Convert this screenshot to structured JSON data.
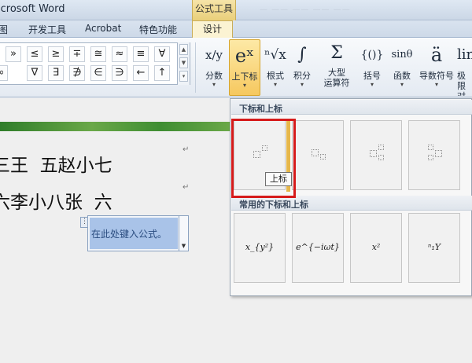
{
  "titlebar": {
    "app_title": "icrosoft Word",
    "context_tab_title": "公式工具",
    "ghost_text": "— ——  ——  —— ——"
  },
  "tabs": {
    "items": [
      "图",
      "开发工具",
      "Acrobat",
      "特色功能"
    ],
    "active": "设计"
  },
  "symbols": {
    "row1": [
      "»",
      "≤",
      "≥",
      "∓",
      "≅",
      "≈",
      "≡",
      "∀"
    ],
    "row2": [
      "∞",
      "∇",
      "∃",
      "∌",
      "∈",
      "∋",
      "←",
      "↑"
    ]
  },
  "ribbon": {
    "fraction": {
      "glyph": "x/y",
      "label": "分数"
    },
    "script": {
      "glyph": "eˣ",
      "label": "上下标"
    },
    "radical": {
      "glyph": "ⁿ√x",
      "label": "根式"
    },
    "integral": {
      "glyph": "∫",
      "label": "积分"
    },
    "large_operator": {
      "glyph": "Σ",
      "label1": "大型",
      "label2": "运算符"
    },
    "bracket": {
      "glyph": "{()}",
      "label": "括号"
    },
    "function": {
      "glyph": "sinθ",
      "label": "函数"
    },
    "accent": {
      "glyph": "ä",
      "label": "导数符号"
    },
    "limit": {
      "glyph": "lin",
      "label1": "极限",
      "label2": "对数"
    }
  },
  "document": {
    "line1": "三王  五赵小七",
    "line2": "六李小八张  六",
    "paragraph_mark": "↵",
    "equation_placeholder": "在此处键入公式。"
  },
  "gallery": {
    "section1_title": "下标和上标",
    "section2_title": "常用的下标和上标",
    "common_samples": [
      "x_{y²}",
      "e^{−iωt}",
      "x²",
      "ⁿ₁Y"
    ],
    "tooltip": "上标"
  },
  "colors": {
    "highlight_red": "#d61b1b",
    "active_button": "#f6c85f",
    "selection_blue": "#a9c3e8"
  }
}
